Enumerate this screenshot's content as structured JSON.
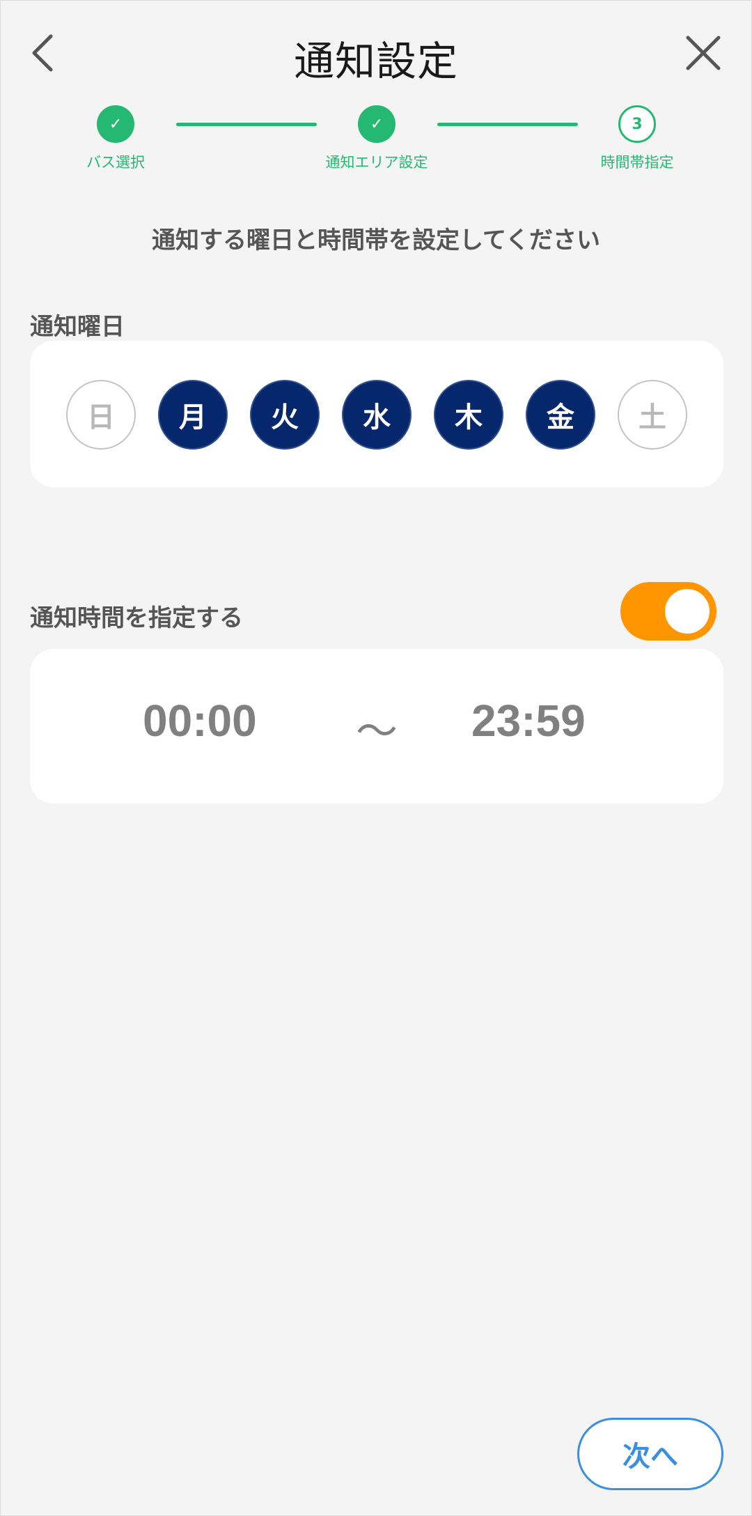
{
  "header": {
    "title": "通知設定",
    "back_icon": "chevron-left-icon",
    "close_icon": "close-icon"
  },
  "stepper": {
    "steps": [
      {
        "label": "バス選択",
        "status": "done",
        "mark": "✓"
      },
      {
        "label": "通知エリア設定",
        "status": "done",
        "mark": "✓"
      },
      {
        "label": "時間帯指定",
        "status": "current",
        "mark": "3"
      }
    ],
    "color": "#25b873"
  },
  "instruction": "通知する曜日と時間帯を設定してください",
  "weekdays": {
    "label": "通知曜日",
    "days": [
      {
        "label": "日",
        "selected": false
      },
      {
        "label": "月",
        "selected": true
      },
      {
        "label": "火",
        "selected": true
      },
      {
        "label": "水",
        "selected": true
      },
      {
        "label": "木",
        "selected": true
      },
      {
        "label": "金",
        "selected": true
      },
      {
        "label": "土",
        "selected": false
      }
    ],
    "selected_color": "#06276b"
  },
  "time_setting": {
    "label": "通知時間を指定する",
    "toggle_on": true,
    "toggle_color": "#ff9500",
    "start": "00:00",
    "separator": "～",
    "end": "23:59"
  },
  "footer": {
    "next_label": "次へ",
    "accent": "#3a8fe0"
  }
}
